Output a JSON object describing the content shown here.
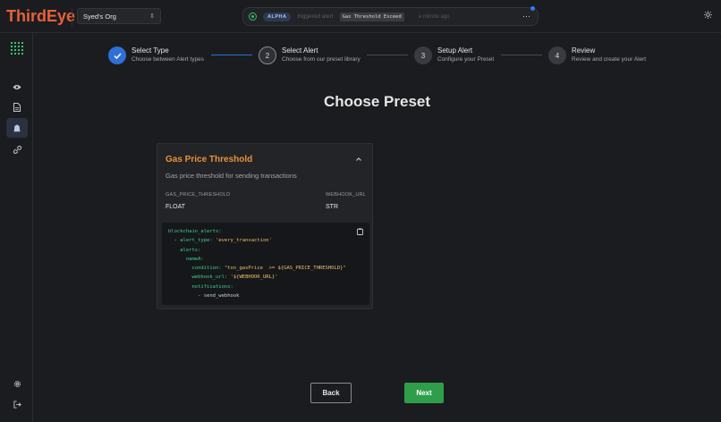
{
  "app": {
    "title": "ThirdEye",
    "brand_color": "#e8613a"
  },
  "org": {
    "selected": "Syed's Org"
  },
  "notification": {
    "badge": "ALPHA",
    "text": "triggered alert",
    "alert_name": "Gas Threshold Exceed",
    "separator": "·",
    "time": "a minute ago"
  },
  "sidebar": {
    "items": [
      {
        "name": "eye-icon",
        "active": false
      },
      {
        "name": "document-icon",
        "active": false
      },
      {
        "name": "alert-icon",
        "active": true
      },
      {
        "name": "link-icon",
        "active": false
      }
    ],
    "bottom": [
      {
        "name": "settings-icon"
      },
      {
        "name": "logout-icon"
      }
    ]
  },
  "stepper": {
    "steps": [
      {
        "number": "1",
        "title": "Select Type",
        "subtitle": "Choose between Alert types",
        "state": "done"
      },
      {
        "number": "2",
        "title": "Select Alert",
        "subtitle": "Choose from our preset library",
        "state": "current"
      },
      {
        "number": "3",
        "title": "Setup Alert",
        "subtitle": "Configure your Preset",
        "state": "pending"
      },
      {
        "number": "4",
        "title": "Review",
        "subtitle": "Review and create your Alert",
        "state": "pending"
      }
    ]
  },
  "page": {
    "title": "Choose Preset"
  },
  "preset": {
    "title": "Gas Price Threshold",
    "description": "Gas price threshold for sending transactions",
    "params": [
      {
        "name": "GAS_PRICE_THRESHOLD",
        "type": "FLOAT"
      },
      {
        "name": "WEBHOOK_URL",
        "type": "STR"
      }
    ],
    "code": {
      "line1_key": "blockchain_alerts:",
      "line2_dash": "- ",
      "line2_key": "alert_type: ",
      "line2_val": "'every_transaction'",
      "line3_key": "alerts:",
      "line4_key": "nameA:",
      "line5_key": "condition: ",
      "line5_val": "\"txn_gasPrice  >= ${GAS_PRICE_THRESHOLD}\"",
      "line6_key": "webhook_url: ",
      "line6_val": "'${WEBHOOK_URL}'",
      "line7_key": "notifications:",
      "line8_dash": "- ",
      "line8_val": "send_webhook"
    }
  },
  "buttons": {
    "back": "Back",
    "next": "Next"
  },
  "colors": {
    "accent_green": "#2e9e4a",
    "step_done": "#2f6fd8",
    "preset_title": "#e8913a"
  }
}
